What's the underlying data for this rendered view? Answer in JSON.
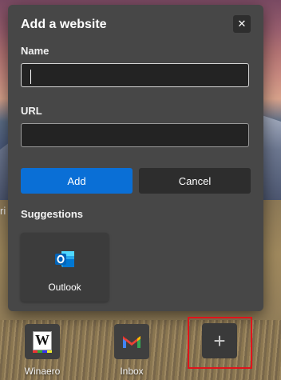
{
  "dialog": {
    "title": "Add a website",
    "close_glyph": "✕",
    "name_label": "Name",
    "name_value": "",
    "url_label": "URL",
    "url_value": "",
    "add_label": "Add",
    "cancel_label": "Cancel",
    "suggestions_label": "Suggestions",
    "suggestions": [
      {
        "label": "Outlook",
        "icon": "outlook-icon"
      }
    ]
  },
  "background_text": "ri",
  "quick_links": [
    {
      "label": "Winaero",
      "icon": "winaero-icon",
      "glyph": "W"
    },
    {
      "label": "Inbox",
      "icon": "gmail-icon"
    }
  ],
  "add_tile_glyph": "+",
  "colors": {
    "accent": "#0a6fd6",
    "dialog_bg": "#474747",
    "highlight": "#e0141b"
  }
}
